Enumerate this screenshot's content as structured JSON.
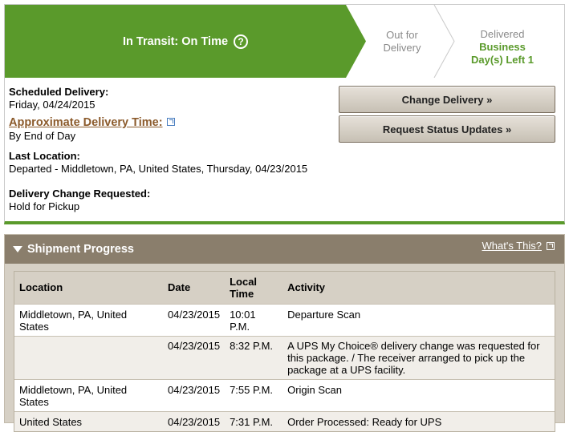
{
  "status": {
    "title": "In Transit: On Time",
    "help_icon": "help-circle-icon",
    "stages": {
      "out_for_delivery": [
        "Out for",
        "Delivery"
      ],
      "delivered_label": "Delivered",
      "delivered_sub": [
        "Business",
        "Day(s) Left 1"
      ]
    },
    "colors": {
      "active": "#5a9a2b",
      "inactive_text": "#8a8a8a"
    }
  },
  "details": {
    "scheduled_label": "Scheduled Delivery:",
    "scheduled_value": "Friday, 04/24/2015",
    "approx_label": "Approximate Delivery Time:",
    "approx_value": "By End of Day",
    "last_location_label": "Last Location:",
    "last_location_value": "Departed - Middletown, PA, United States, Thursday, 04/23/2015",
    "change_label": "Delivery Change Requested:",
    "change_value": "Hold for Pickup"
  },
  "buttons": {
    "change_delivery": "Change Delivery »",
    "request_updates": "Request Status Updates »"
  },
  "shipment": {
    "title": "Shipment Progress",
    "whats_this": "What's This?",
    "columns": [
      "Location",
      "Date",
      "Local\nTime",
      "Activity"
    ],
    "rows": [
      {
        "location": "Middletown, PA, United States",
        "date": "04/23/2015",
        "time": "10:01 P.M.",
        "activity": "Departure Scan"
      },
      {
        "location": "",
        "date": "04/23/2015",
        "time": "8:32 P.M.",
        "activity": "A UPS My Choice® delivery change was requested for this package. / The receiver arranged to pick up the package at a UPS facility."
      },
      {
        "location": "Middletown, PA, United States",
        "date": "04/23/2015",
        "time": "7:55 P.M.",
        "activity": "Origin Scan"
      },
      {
        "location": "United States",
        "date": "04/23/2015",
        "time": "7:31 P.M.",
        "activity": "Order Processed: Ready for UPS"
      }
    ]
  }
}
